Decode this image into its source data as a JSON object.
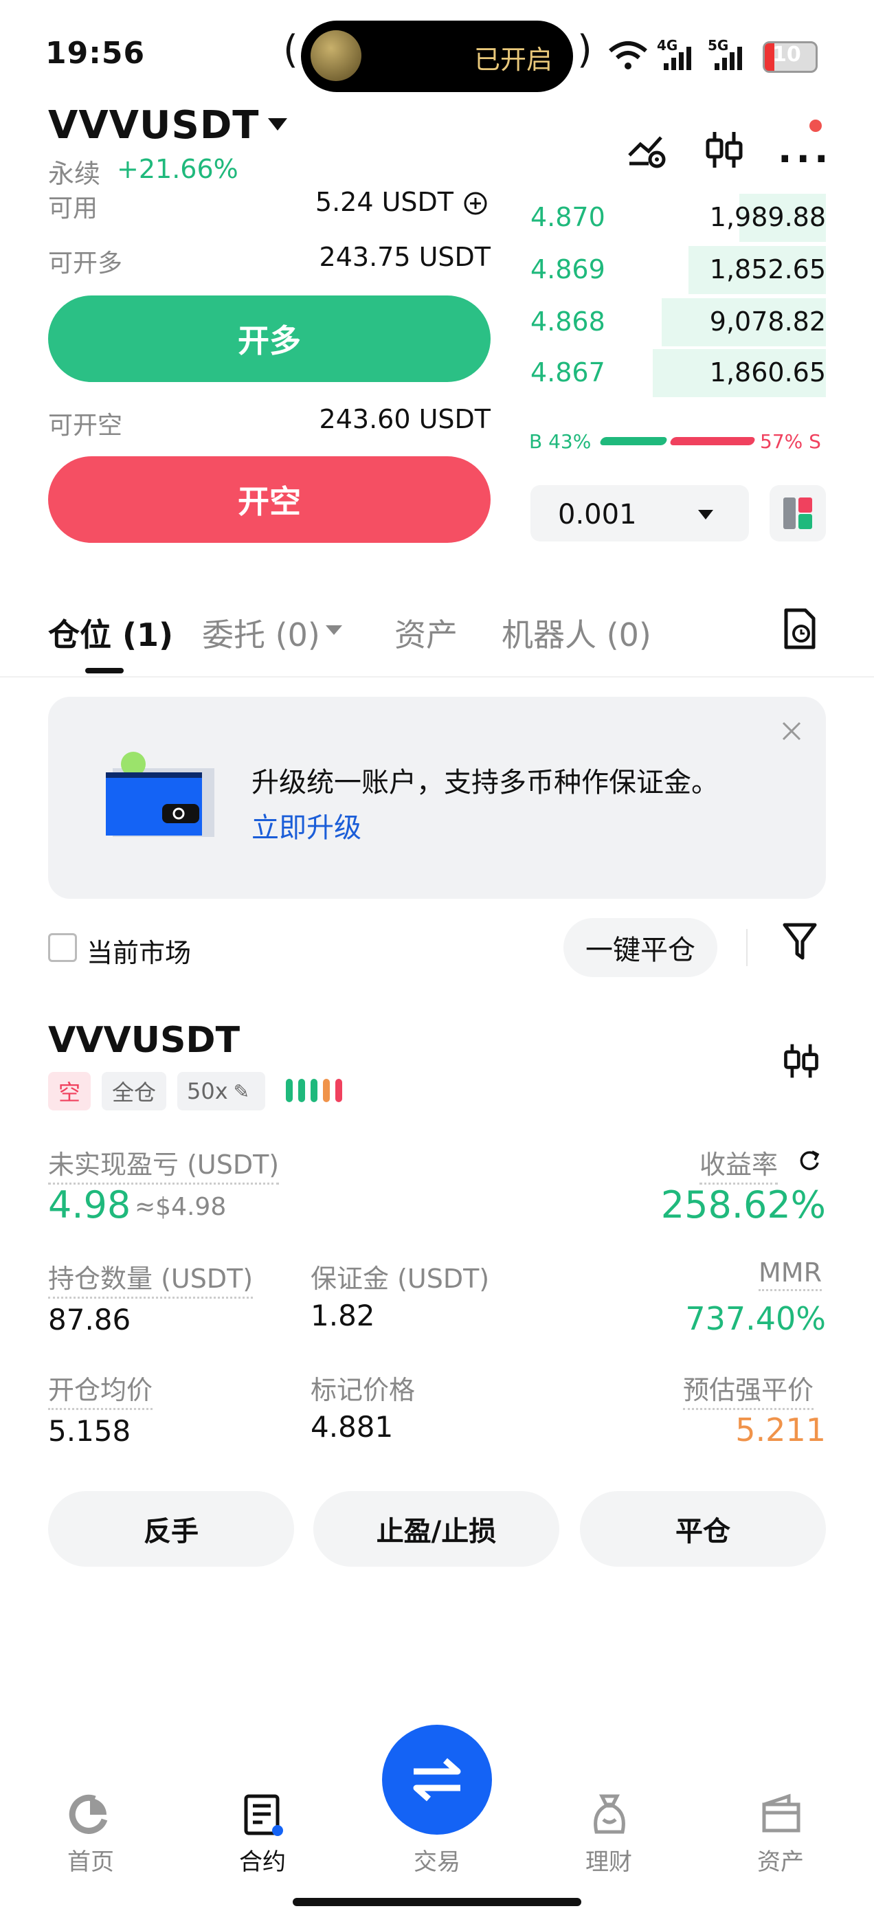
{
  "status_bar": {
    "time": "19:56",
    "island_text": "已开启",
    "battery": "10",
    "net_1": "4G",
    "net_2": "5G"
  },
  "header": {
    "symbol": "VVVUSDT",
    "type": "永续",
    "change": "+21.66%"
  },
  "trade_form": {
    "available_label": "可用",
    "available_value": "5.24 USDT",
    "long_max_label": "可开多",
    "long_max_value": "243.75 USDT",
    "long_button": "开多",
    "short_max_label": "可开空",
    "short_max_value": "243.60 USDT",
    "short_button": "开空"
  },
  "order_book": {
    "rows": [
      {
        "price": "4.870",
        "qty": "1,989.88",
        "depth": 0.29
      },
      {
        "price": "4.869",
        "qty": "1,852.65",
        "depth": 0.46
      },
      {
        "price": "4.868",
        "qty": "9,078.82",
        "depth": 0.55
      },
      {
        "price": "4.867",
        "qty": "1,860.65",
        "depth": 0.58
      }
    ],
    "buy_ratio": "B 43%",
    "sell_ratio": "57% S",
    "precision": "0.001"
  },
  "tabs": [
    {
      "label": "仓位 (1)"
    },
    {
      "label": "委托 (0)"
    },
    {
      "label": "资产"
    },
    {
      "label": "机器人 (0)"
    }
  ],
  "banner": {
    "text": "升级统一账户，支持多币种作保证金。",
    "link": "立即升级"
  },
  "filters": {
    "current_market": "当前市场",
    "close_all": "一键平仓"
  },
  "position": {
    "symbol": "VVVUSDT",
    "side_tag": "空",
    "margin_mode": "全仓",
    "leverage": "50x",
    "pnl_label": "未实现盈亏 (USDT)",
    "pnl_value": "4.98",
    "pnl_usd": "≈$4.98",
    "roe_label": "收益率",
    "roe_value": "258.62%",
    "size_label": "持仓数量 (USDT)",
    "size_value": "87.86",
    "margin_label": "保证金 (USDT)",
    "margin_value": "1.82",
    "mmr_label": "MMR",
    "mmr_value": "737.40%",
    "entry_label": "开仓均价",
    "entry_value": "5.158",
    "mark_label": "标记价格",
    "mark_value": "4.881",
    "liq_label": "预估强平价",
    "liq_value": "5.211",
    "buttons": {
      "reverse": "反手",
      "tpsl": "止盈/止损",
      "close": "平仓"
    }
  },
  "bottom_nav": [
    {
      "label": "首页",
      "icon": "home-icon"
    },
    {
      "label": "合约",
      "icon": "contract-icon"
    },
    {
      "label": "交易",
      "icon": "swap-icon"
    },
    {
      "label": "理财",
      "icon": "finance-icon"
    },
    {
      "label": "资产",
      "icon": "wallet-icon"
    }
  ],
  "colors": {
    "green": "#1fb97c",
    "red": "#f54f63",
    "blue": "#1463f5",
    "orange": "#f0934a"
  }
}
